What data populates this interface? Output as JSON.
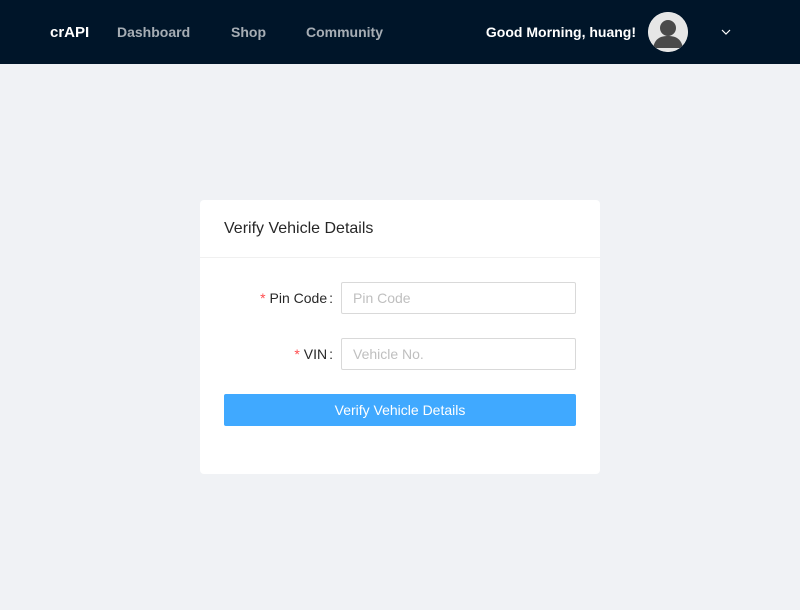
{
  "header": {
    "brand": "crAPI",
    "nav": {
      "dashboard": "Dashboard",
      "shop": "Shop",
      "community": "Community"
    },
    "greeting": "Good Morning, huang!",
    "avatar_icon": "user-avatar-icon",
    "dropdown_icon": "chevron-down-icon"
  },
  "form": {
    "title": "Verify Vehicle Details",
    "required_mark": "*",
    "pin": {
      "label": "Pin Code",
      "placeholder": "Pin Code",
      "value": ""
    },
    "vin": {
      "label": "VIN",
      "placeholder": "Vehicle No.",
      "value": ""
    },
    "submit_label": "Verify Vehicle Details"
  },
  "colors": {
    "navbar": "#001529",
    "page_background": "#f0f2f5",
    "primary_button": "#40a9ff",
    "required": "#ff4d4f"
  }
}
